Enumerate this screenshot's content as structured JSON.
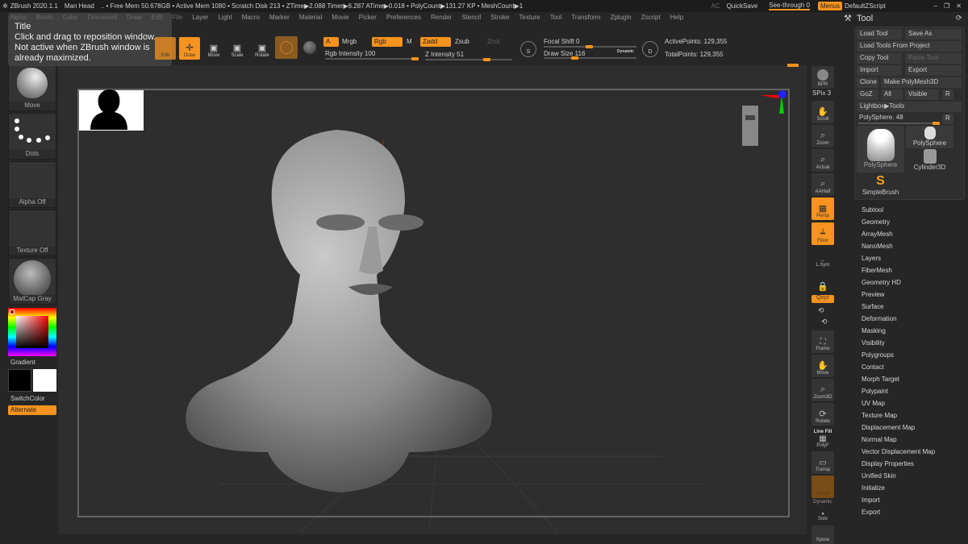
{
  "titlebar": {
    "app": "ZBrush 2020.1.1",
    "doc": "Man Head",
    "stats": ".. • Free Mem 50.678GB • Active Mem 1080 • Scratch Disk 213 • ZTime▶2.088 Timer▶6.287 ATime▶0.018 • PolyCount▶131.27 KP • MeshCount▶1",
    "ac": "AC",
    "quicksave": "QuickSave",
    "see_through": "See-through  0",
    "menus": "Menus",
    "script": "DefaultZScript"
  },
  "menus": [
    "Alpha",
    "Brush",
    "Color",
    "Document",
    "Draw",
    "Edit",
    "File",
    "Layer",
    "Light",
    "Macro",
    "Marker",
    "Material",
    "Movie",
    "Picker",
    "Preferences",
    "Render",
    "Stencil",
    "Stroke",
    "Texture",
    "Tool",
    "Transform",
    "Zplugin",
    "Zscript",
    "Help"
  ],
  "tooltip": {
    "title": "Title",
    "line1": "Click and drag to reposition window.",
    "line2": "Not active when ZBrush window is already maximized."
  },
  "toolbar": {
    "edit": "Edit",
    "draw": "Draw",
    "move": "Move",
    "scale": "Scale",
    "rotate": "Rotate",
    "a": "A",
    "mrgb": "Mrgb",
    "rgb": "Rgb",
    "m": "M",
    "zadd": "Zadd",
    "zsub": "Zsub",
    "zcut": "Zcut",
    "rgb_intensity": "Rgb Intensity 100",
    "z_intensity": "Z Intensity 51",
    "focal_shift": "Focal Shift 0",
    "draw_size": "Draw Size 116",
    "dynamic": "Dynamic",
    "active_points": "ActivePoints: 129,355",
    "total_points": "TotalPoints: 129,355",
    "rgb_intensity_value": 100,
    "z_intensity_value": 51,
    "focal_shift_value": 0,
    "draw_size_value": 116
  },
  "left_shelf": {
    "brush": "Move",
    "stroke": "Dots",
    "alpha": "Alpha Off",
    "texture": "Texture Off",
    "material": "MatCap Gray",
    "gradient": "Gradient",
    "switch": "SwitchColor",
    "alternate": "Alternate"
  },
  "right_shelf": {
    "bpr": "BPR",
    "spix": "SPix 3",
    "scroll": "Scroll",
    "zoom": "Zoom",
    "actual": "Actual",
    "aahalf": "AAHalf",
    "persp": "Persp",
    "floor": "Floor",
    "lsym": "L.Sym",
    "xyz": "Qxyz",
    "frame": "Frame",
    "move": "Move",
    "zoom3d": "Zoom3D",
    "rotate": "Rotate",
    "linefill": "Line Fill",
    "polyf": "PolyF",
    "transp": "Transp",
    "ghost": "Ghost",
    "dynamic": "Dynamic",
    "solo": "Solo",
    "xpose": "Xpose"
  },
  "tool_panel": {
    "title": "Tool",
    "load_tool": "Load Tool",
    "save_as": "Save As",
    "load_from_project": "Load Tools From Project",
    "copy_tool": "Copy Tool",
    "paste_tool": "Paste Tool",
    "import": "Import",
    "export": "Export",
    "clone": "Clone",
    "make_polymesh": "Make PolyMesh3D",
    "goz": "GoZ",
    "all": "All",
    "visible": "Visible",
    "r": "R",
    "lightbox": "Lightbox▶Tools",
    "current": "PolySphere. 48",
    "thumbs": [
      "PolySphere",
      "PolySphere",
      "Cylinder3D",
      "SimpleBrush"
    ],
    "subpalettes": [
      "Subtool",
      "Geometry",
      "ArrayMesh",
      "NanoMesh",
      "Layers",
      "FiberMesh",
      "Geometry HD",
      "Preview",
      "Surface",
      "Deformation",
      "Masking",
      "Visibility",
      "Polygroups",
      "Contact",
      "Morph Target",
      "Polypaint",
      "UV Map",
      "Texture Map",
      "Displacement Map",
      "Normal Map",
      "Vector Displacement Map",
      "Display Properties",
      "Unified Skin",
      "Initialize",
      "Import",
      "Export"
    ]
  }
}
